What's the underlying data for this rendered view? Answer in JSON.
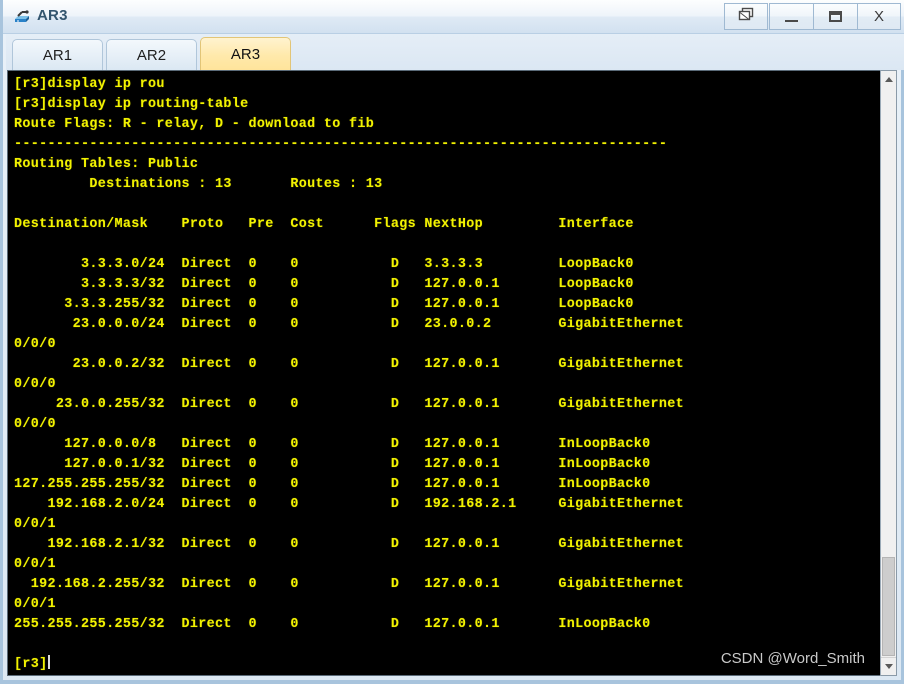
{
  "window": {
    "title": "AR3",
    "app_icon": "router-icon",
    "controls": [
      {
        "name": "restore-button",
        "glyph": "restore-icon",
        "label": "Restore"
      },
      {
        "name": "minimize-button",
        "glyph": "minimize-icon",
        "label": "Minimize"
      },
      {
        "name": "maximize-button",
        "glyph": "maximize-icon",
        "label": "Maximize"
      },
      {
        "name": "close-button",
        "glyph": "X",
        "label": "Close"
      }
    ]
  },
  "tabs": [
    {
      "label": "AR1",
      "active": false
    },
    {
      "label": "AR2",
      "active": false
    },
    {
      "label": "AR3",
      "active": true
    }
  ],
  "terminal": {
    "background": "#000000",
    "foreground": "#f2f200",
    "lines": [
      "[r3]display ip rou",
      "[r3]display ip routing-table",
      "Route Flags: R - relay, D - download to fib",
      "------------------------------------------------------------------------------",
      "Routing Tables: Public",
      "         Destinations : 13       Routes : 13",
      "",
      "Destination/Mask    Proto   Pre  Cost      Flags NextHop         Interface",
      "",
      "        3.3.3.0/24  Direct  0    0           D   3.3.3.3         LoopBack0",
      "        3.3.3.3/32  Direct  0    0           D   127.0.0.1       LoopBack0",
      "      3.3.3.255/32  Direct  0    0           D   127.0.0.1       LoopBack0",
      "       23.0.0.0/24  Direct  0    0           D   23.0.0.2        GigabitEthernet",
      "0/0/0",
      "       23.0.0.2/32  Direct  0    0           D   127.0.0.1       GigabitEthernet",
      "0/0/0",
      "     23.0.0.255/32  Direct  0    0           D   127.0.0.1       GigabitEthernet",
      "0/0/0",
      "      127.0.0.0/8   Direct  0    0           D   127.0.0.1       InLoopBack0",
      "      127.0.0.1/32  Direct  0    0           D   127.0.0.1       InLoopBack0",
      "127.255.255.255/32  Direct  0    0           D   127.0.0.1       InLoopBack0",
      "    192.168.2.0/24  Direct  0    0           D   192.168.2.1     GigabitEthernet",
      "0/0/1",
      "    192.168.2.1/32  Direct  0    0           D   127.0.0.1       GigabitEthernet",
      "0/0/1",
      "  192.168.2.255/32  Direct  0    0           D   127.0.0.1       GigabitEthernet",
      "0/0/1",
      "255.255.255.255/32  Direct  0    0           D   127.0.0.1       InLoopBack0",
      "",
      "[r3]"
    ],
    "prompt": "[r3]",
    "routing_table": {
      "flags_legend": "Route Flags: R - relay, D - download to fib",
      "table_name": "Routing Tables: Public",
      "destinations": "13",
      "routes": "13",
      "columns": [
        "Destination/Mask",
        "Proto",
        "Pre",
        "Cost",
        "Flags",
        "NextHop",
        "Interface"
      ],
      "rows": [
        {
          "destination": "3.3.3.0/24",
          "proto": "Direct",
          "pre": "0",
          "cost": "0",
          "flags": "D",
          "nexthop": "3.3.3.3",
          "interface": "LoopBack0"
        },
        {
          "destination": "3.3.3.3/32",
          "proto": "Direct",
          "pre": "0",
          "cost": "0",
          "flags": "D",
          "nexthop": "127.0.0.1",
          "interface": "LoopBack0"
        },
        {
          "destination": "3.3.3.255/32",
          "proto": "Direct",
          "pre": "0",
          "cost": "0",
          "flags": "D",
          "nexthop": "127.0.0.1",
          "interface": "LoopBack0"
        },
        {
          "destination": "23.0.0.0/24",
          "proto": "Direct",
          "pre": "0",
          "cost": "0",
          "flags": "D",
          "nexthop": "23.0.0.2",
          "interface": "GigabitEthernet0/0/0"
        },
        {
          "destination": "23.0.0.2/32",
          "proto": "Direct",
          "pre": "0",
          "cost": "0",
          "flags": "D",
          "nexthop": "127.0.0.1",
          "interface": "GigabitEthernet0/0/0"
        },
        {
          "destination": "23.0.0.255/32",
          "proto": "Direct",
          "pre": "0",
          "cost": "0",
          "flags": "D",
          "nexthop": "127.0.0.1",
          "interface": "GigabitEthernet0/0/0"
        },
        {
          "destination": "127.0.0.0/8",
          "proto": "Direct",
          "pre": "0",
          "cost": "0",
          "flags": "D",
          "nexthop": "127.0.0.1",
          "interface": "InLoopBack0"
        },
        {
          "destination": "127.0.0.1/32",
          "proto": "Direct",
          "pre": "0",
          "cost": "0",
          "flags": "D",
          "nexthop": "127.0.0.1",
          "interface": "InLoopBack0"
        },
        {
          "destination": "127.255.255.255/32",
          "proto": "Direct",
          "pre": "0",
          "cost": "0",
          "flags": "D",
          "nexthop": "127.0.0.1",
          "interface": "InLoopBack0"
        },
        {
          "destination": "192.168.2.0/24",
          "proto": "Direct",
          "pre": "0",
          "cost": "0",
          "flags": "D",
          "nexthop": "192.168.2.1",
          "interface": "GigabitEthernet0/0/1"
        },
        {
          "destination": "192.168.2.1/32",
          "proto": "Direct",
          "pre": "0",
          "cost": "0",
          "flags": "D",
          "nexthop": "127.0.0.1",
          "interface": "GigabitEthernet0/0/1"
        },
        {
          "destination": "192.168.2.255/32",
          "proto": "Direct",
          "pre": "0",
          "cost": "0",
          "flags": "D",
          "nexthop": "127.0.0.1",
          "interface": "GigabitEthernet0/0/1"
        },
        {
          "destination": "255.255.255.255/32",
          "proto": "Direct",
          "pre": "0",
          "cost": "0",
          "flags": "D",
          "nexthop": "127.0.0.1",
          "interface": "InLoopBack0"
        }
      ]
    }
  },
  "watermark": "CSDN @Word_Smith",
  "scrollbar": {
    "up_arrow": "chevron-up-icon",
    "down_arrow": "chevron-down-icon"
  }
}
